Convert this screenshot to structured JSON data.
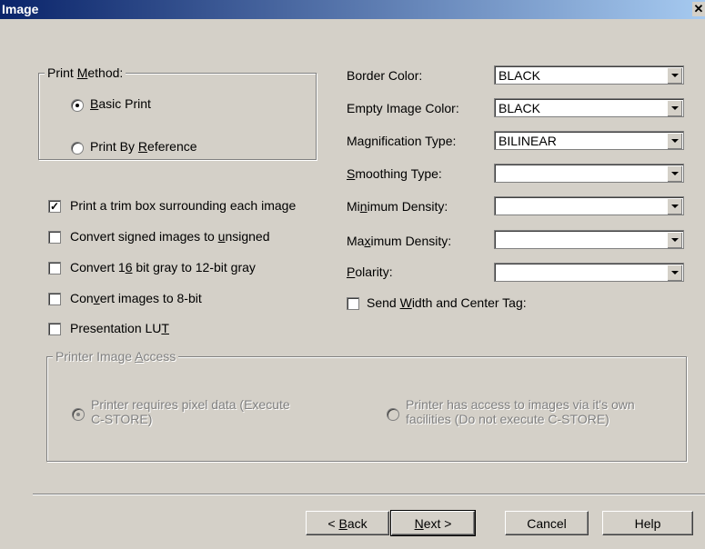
{
  "title": "Image",
  "print_method": {
    "label": "Print Method:",
    "options": [
      "Basic Print",
      "Print By Reference"
    ],
    "selected": "Basic Print"
  },
  "checkboxes": [
    {
      "label": "Print a trim box surrounding each image",
      "checked": true
    },
    {
      "label": "Convert signed images to unsigned",
      "checked": false
    },
    {
      "label": "Convert 16 bit gray to 12-bit gray",
      "checked": false
    },
    {
      "label": "Convert images to 8-bit",
      "checked": false
    },
    {
      "label": "Presentation LUT",
      "checked": false
    }
  ],
  "fields": [
    {
      "label": "Border Color:",
      "value": "BLACK"
    },
    {
      "label": "Empty Image Color:",
      "value": "BLACK"
    },
    {
      "label": "Magnification Type:",
      "value": "BILINEAR"
    },
    {
      "label": "Smoothing Type:",
      "value": ""
    },
    {
      "label": "Minimum Density:",
      "value": ""
    },
    {
      "label": "Maximum Density:",
      "value": ""
    },
    {
      "label": "Polarity:",
      "value": ""
    }
  ],
  "send_width": {
    "label": "Send Width and Center Tag:",
    "checked": false
  },
  "printer_access": {
    "label": "Printer Image Access",
    "options": [
      "Printer requires pixel data (Execute C-STORE)",
      "Printer has access to images via it's own facilities (Do not execute C-STORE)"
    ],
    "selected": "Printer requires pixel data (Execute C-STORE)"
  },
  "buttons": {
    "back": "< Back",
    "next": "Next >",
    "cancel": "Cancel",
    "help": "Help"
  }
}
